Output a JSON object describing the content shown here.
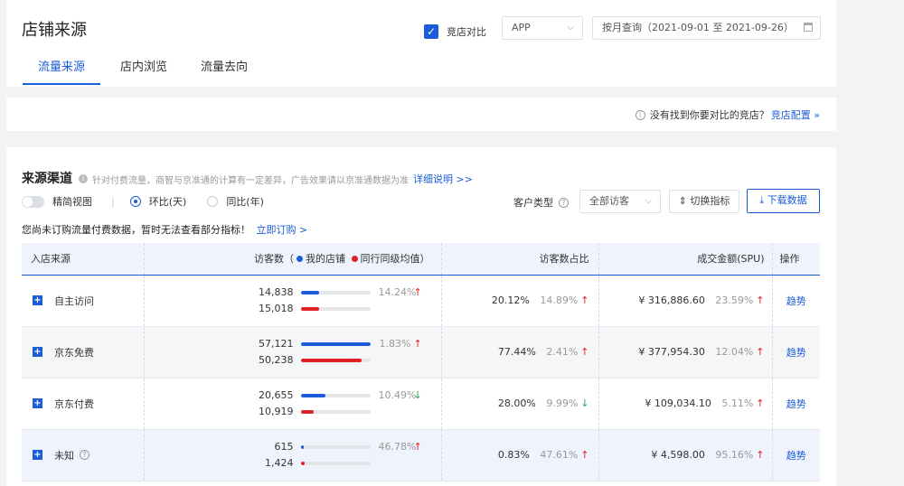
{
  "header": {
    "title": "店铺来源",
    "compare_label": "竞店对比",
    "platform": "APP",
    "date_range": "按月查询（2021-09-01 至 2021-09-26）",
    "tabs": [
      {
        "label": "流量来源",
        "active": true
      },
      {
        "label": "店内浏览",
        "active": false
      },
      {
        "label": "流量去向",
        "active": false
      }
    ]
  },
  "notice": {
    "text": "没有找到你要对比的竞店？",
    "link": "竞店配置 »"
  },
  "section": {
    "title": "来源渠道",
    "desc": "针对付费流量，商智与京准通的计算有一定差异，广告效果请以京准通数据为准",
    "desc_link": "详细说明 >>",
    "toggle_label": "精简视图",
    "radio_1": "环比(天)",
    "radio_2": "同比(年)",
    "customer_type_label": "客户类型",
    "customer_type_value": "全部访客",
    "switch_btn": "切换指标",
    "download_btn": "下载数据",
    "warn_text": "您尚未订购流量付费数据，暂时无法查看部分指标！",
    "warn_link": "立即订购 >"
  },
  "table": {
    "headers": {
      "source": "入店来源",
      "visitors_prefix": "访客数（",
      "mine": "我的店铺",
      "peer": "同行同级均值",
      "visitors_suffix": "）",
      "ratio": "访客数占比",
      "amount": "成交金额(SPU)",
      "op": "操作"
    },
    "rows": [
      {
        "source": "自主访问",
        "mine": "14,838",
        "peer": "15,018",
        "mine_pct": 0.26,
        "peer_pct": 0.26,
        "vis_change": "14.24%",
        "vis_dir": "up",
        "ratio": "20.12%",
        "ratio_change": "14.89%",
        "ratio_dir": "up",
        "amount": "¥ 316,886.60",
        "amount_change": "23.59%",
        "amount_dir": "up",
        "op": "趋势"
      },
      {
        "source": "京东免费",
        "mine": "57,121",
        "peer": "50,238",
        "mine_pct": 1.0,
        "peer_pct": 0.88,
        "vis_change": "1.83%",
        "vis_dir": "up",
        "ratio": "77.44%",
        "ratio_change": "2.41%",
        "ratio_dir": "up",
        "amount": "¥ 377,954.30",
        "amount_change": "12.04%",
        "amount_dir": "up",
        "op": "趋势"
      },
      {
        "source": "京东付费",
        "mine": "20,655",
        "peer": "10,919",
        "mine_pct": 0.36,
        "peer_pct": 0.19,
        "vis_change": "10.49%",
        "vis_dir": "down",
        "ratio": "28.00%",
        "ratio_change": "9.99%",
        "ratio_dir": "down",
        "amount": "¥ 109,034.10",
        "amount_change": "5.11%",
        "amount_dir": "up",
        "op": "趋势"
      },
      {
        "source": "未知",
        "mine": "615",
        "peer": "1,424",
        "mine_pct": 0.04,
        "peer_pct": 0.06,
        "vis_change": "46.78%",
        "vis_dir": "up",
        "ratio": "0.83%",
        "ratio_change": "47.61%",
        "ratio_dir": "up",
        "amount": "¥ 4,598.00",
        "amount_change": "95.16%",
        "amount_dir": "up",
        "op": "趋势",
        "has_info": true
      }
    ]
  },
  "colors": {
    "accent": "#1b5cd8",
    "up": "#e02020",
    "down": "#2ea44f"
  }
}
